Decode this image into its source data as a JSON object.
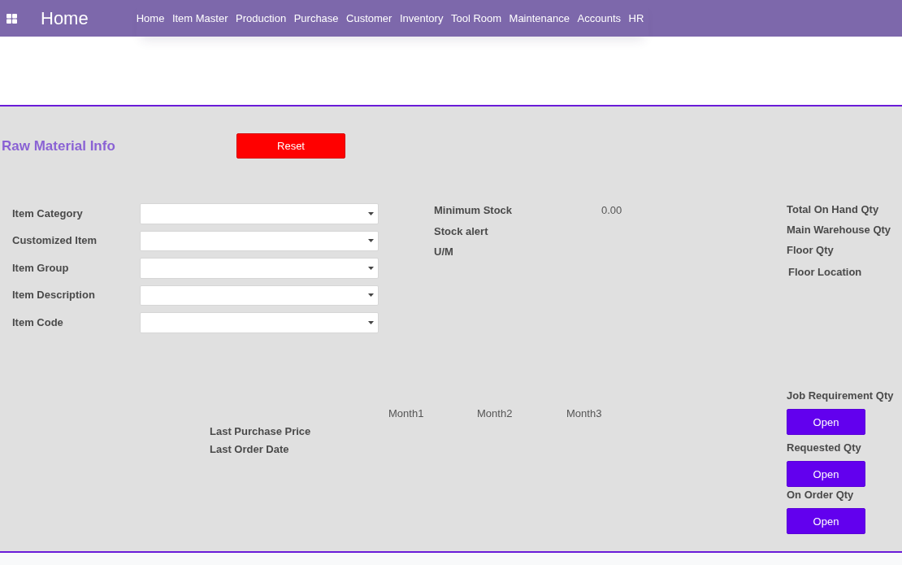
{
  "top_bar": {
    "brand": "Home",
    "nav_items": [
      "Home",
      "Item Master",
      "Production",
      "Purchase",
      "Customer",
      "Inventory",
      "Tool Room",
      "Maintenance",
      "Accounts",
      "HR"
    ]
  },
  "panel": {
    "title": "Raw Material Info",
    "reset_button": "Reset",
    "form_fields": [
      {
        "label": "Item Category"
      },
      {
        "label": "Customized Item"
      },
      {
        "label": "Item Group"
      },
      {
        "label": "Item Description"
      },
      {
        "label": "Item Code"
      }
    ],
    "stock_info": [
      {
        "label": "Minimum Stock",
        "value": "0.00"
      },
      {
        "label": "Stock alert"
      },
      {
        "label": "U/M"
      }
    ],
    "quantities": [
      "Total On Hand Qty",
      "Main Warehouse Qty",
      "Floor Qty",
      "Floor Location"
    ],
    "purchase_history": {
      "columns": [
        "Month1",
        "Month2",
        "Month3"
      ],
      "rows": [
        "Last Purchase Price",
        "Last Order Date"
      ]
    },
    "open_actions": [
      {
        "label": "Job Requirement Qty",
        "button": "Open"
      },
      {
        "label": "Requested Qty",
        "button": "Open"
      },
      {
        "label": "On Order Qty",
        "button": "Open"
      }
    ]
  }
}
